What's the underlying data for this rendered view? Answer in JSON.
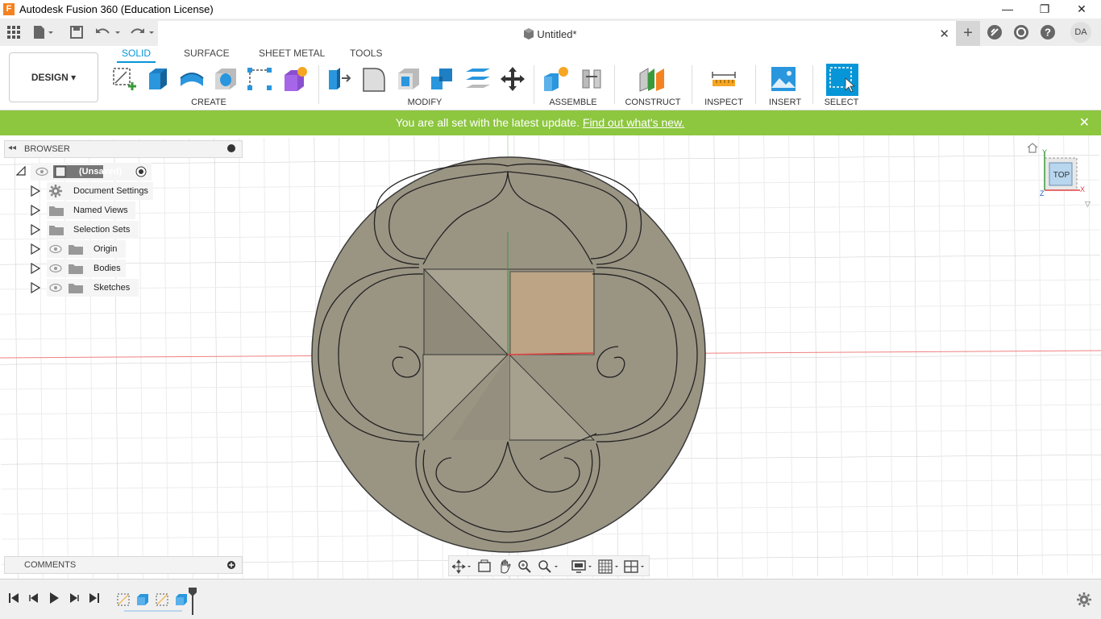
{
  "window": {
    "title": "Autodesk Fusion 360 (Education License)",
    "logo_letter": "F",
    "minimize": "—",
    "maximize": "❐",
    "close": "✕"
  },
  "appbar": {
    "document_title": "Untitled*",
    "close_tab": "✕",
    "new_tab": "+",
    "user_initials": "DA"
  },
  "ribbon": {
    "workspace": "DESIGN ▾",
    "tabs": [
      "SOLID",
      "SURFACE",
      "SHEET METAL",
      "TOOLS"
    ],
    "active_tab": "SOLID",
    "groups": {
      "create": "CREATE ▾",
      "modify": "MODIFY ▾",
      "assemble": "ASSEMBLE ▾",
      "construct": "CONSTRUCT ▾",
      "inspect": "INSPECT ▾",
      "insert": "INSERT ▾",
      "select": "SELECT ▾"
    }
  },
  "notification": {
    "message": "You are all set with the latest update. ",
    "link": "Find out what's new.",
    "close": "✕"
  },
  "browser": {
    "title": "BROWSER",
    "root": "(Unsaved)",
    "items": [
      {
        "label": "Document Settings",
        "icon": "gear-icon"
      },
      {
        "label": "Named Views",
        "icon": "folder-icon"
      },
      {
        "label": "Selection Sets",
        "icon": "folder-icon"
      },
      {
        "label": "Origin",
        "icon": "folder-icon"
      },
      {
        "label": "Bodies",
        "icon": "folder-icon"
      },
      {
        "label": "Sketches",
        "icon": "folder-icon"
      }
    ]
  },
  "comments": {
    "title": "COMMENTS"
  },
  "viewcube": {
    "face": "TOP",
    "axis_x": "X",
    "axis_y": "Y",
    "axis_z": "Z"
  },
  "colors": {
    "accent": "#0696d7",
    "notify_bg": "#8dc63f",
    "body_fill": "#9a9483"
  }
}
